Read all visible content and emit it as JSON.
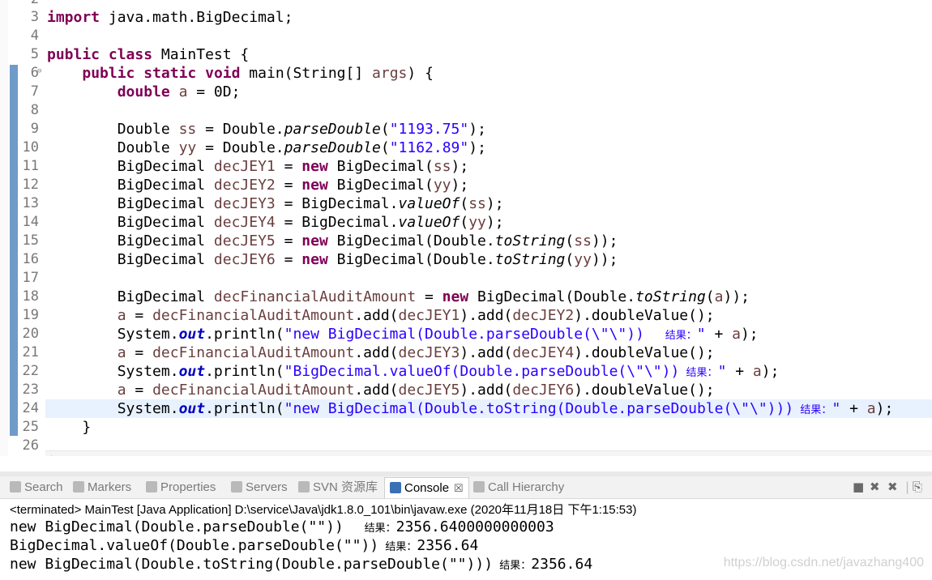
{
  "editor": {
    "first_line_partial": "2",
    "lines": [
      {
        "n": "3",
        "code": [
          {
            "t": "import",
            "c": "kw"
          },
          {
            "t": " java.math.BigDecimal;"
          }
        ]
      },
      {
        "n": "4",
        "code": []
      },
      {
        "n": "5",
        "code": [
          {
            "t": "public",
            "c": "kw"
          },
          {
            "t": " "
          },
          {
            "t": "class",
            "c": "kw"
          },
          {
            "t": " MainTest {"
          }
        ]
      },
      {
        "n": "6",
        "fold": "⊖",
        "code": [
          {
            "t": "    "
          },
          {
            "t": "public",
            "c": "kw"
          },
          {
            "t": " "
          },
          {
            "t": "static",
            "c": "kw"
          },
          {
            "t": " "
          },
          {
            "t": "void",
            "c": "kw"
          },
          {
            "t": " main(String[] "
          },
          {
            "t": "args",
            "c": "var"
          },
          {
            "t": ") {"
          }
        ]
      },
      {
        "n": "7",
        "code": [
          {
            "t": "        "
          },
          {
            "t": "double",
            "c": "kw"
          },
          {
            "t": " "
          },
          {
            "t": "a",
            "c": "var"
          },
          {
            "t": " = 0D;"
          }
        ]
      },
      {
        "n": "8",
        "code": []
      },
      {
        "n": "9",
        "code": [
          {
            "t": "        Double "
          },
          {
            "t": "ss",
            "c": "var"
          },
          {
            "t": " = Double."
          },
          {
            "t": "parseDouble",
            "c": "it"
          },
          {
            "t": "("
          },
          {
            "t": "\"1193.75\"",
            "c": "str"
          },
          {
            "t": ");"
          }
        ]
      },
      {
        "n": "10",
        "code": [
          {
            "t": "        Double "
          },
          {
            "t": "yy",
            "c": "var"
          },
          {
            "t": " = Double."
          },
          {
            "t": "parseDouble",
            "c": "it"
          },
          {
            "t": "("
          },
          {
            "t": "\"1162.89\"",
            "c": "str"
          },
          {
            "t": ");"
          }
        ]
      },
      {
        "n": "11",
        "code": [
          {
            "t": "        BigDecimal "
          },
          {
            "t": "decJEY1",
            "c": "var"
          },
          {
            "t": " = "
          },
          {
            "t": "new",
            "c": "kw"
          },
          {
            "t": " BigDecimal("
          },
          {
            "t": "ss",
            "c": "var"
          },
          {
            "t": ");"
          }
        ]
      },
      {
        "n": "12",
        "code": [
          {
            "t": "        BigDecimal "
          },
          {
            "t": "decJEY2",
            "c": "var"
          },
          {
            "t": " = "
          },
          {
            "t": "new",
            "c": "kw"
          },
          {
            "t": " BigDecimal("
          },
          {
            "t": "yy",
            "c": "var"
          },
          {
            "t": ");"
          }
        ]
      },
      {
        "n": "13",
        "code": [
          {
            "t": "        BigDecimal "
          },
          {
            "t": "decJEY3",
            "c": "var"
          },
          {
            "t": " = BigDecimal."
          },
          {
            "t": "valueOf",
            "c": "it"
          },
          {
            "t": "("
          },
          {
            "t": "ss",
            "c": "var"
          },
          {
            "t": ");"
          }
        ]
      },
      {
        "n": "14",
        "code": [
          {
            "t": "        BigDecimal "
          },
          {
            "t": "decJEY4",
            "c": "var"
          },
          {
            "t": " = BigDecimal."
          },
          {
            "t": "valueOf",
            "c": "it"
          },
          {
            "t": "("
          },
          {
            "t": "yy",
            "c": "var"
          },
          {
            "t": ");"
          }
        ]
      },
      {
        "n": "15",
        "code": [
          {
            "t": "        BigDecimal "
          },
          {
            "t": "decJEY5",
            "c": "var"
          },
          {
            "t": " = "
          },
          {
            "t": "new",
            "c": "kw"
          },
          {
            "t": " BigDecimal(Double."
          },
          {
            "t": "toString",
            "c": "it"
          },
          {
            "t": "("
          },
          {
            "t": "ss",
            "c": "var"
          },
          {
            "t": "));"
          }
        ]
      },
      {
        "n": "16",
        "code": [
          {
            "t": "        BigDecimal "
          },
          {
            "t": "decJEY6",
            "c": "var"
          },
          {
            "t": " = "
          },
          {
            "t": "new",
            "c": "kw"
          },
          {
            "t": " BigDecimal(Double."
          },
          {
            "t": "toString",
            "c": "it"
          },
          {
            "t": "("
          },
          {
            "t": "yy",
            "c": "var"
          },
          {
            "t": "));"
          }
        ]
      },
      {
        "n": "17",
        "code": []
      },
      {
        "n": "18",
        "code": [
          {
            "t": "        BigDecimal "
          },
          {
            "t": "decFinancialAuditAmount",
            "c": "var"
          },
          {
            "t": " = "
          },
          {
            "t": "new",
            "c": "kw"
          },
          {
            "t": " BigDecimal(Double."
          },
          {
            "t": "toString",
            "c": "it"
          },
          {
            "t": "("
          },
          {
            "t": "a",
            "c": "var"
          },
          {
            "t": "));"
          }
        ]
      },
      {
        "n": "19",
        "code": [
          {
            "t": "        "
          },
          {
            "t": "a",
            "c": "var"
          },
          {
            "t": " = "
          },
          {
            "t": "decFinancialAuditAmount",
            "c": "var"
          },
          {
            "t": ".add("
          },
          {
            "t": "decJEY1",
            "c": "var"
          },
          {
            "t": ").add("
          },
          {
            "t": "decJEY2",
            "c": "var"
          },
          {
            "t": ").doubleValue();"
          }
        ]
      },
      {
        "n": "20",
        "code": [
          {
            "t": "        System."
          },
          {
            "t": "out",
            "c": "fld"
          },
          {
            "t": ".println("
          },
          {
            "t": "\"new BigDecimal(Double.parseDouble(\\\"\\\"))  ",
            "c": "str"
          },
          {
            "t": " 结果：",
            "c": "str cn"
          },
          {
            "t": "\"",
            "c": "str"
          },
          {
            "t": " + "
          },
          {
            "t": "a",
            "c": "var"
          },
          {
            "t": ");"
          }
        ]
      },
      {
        "n": "21",
        "code": [
          {
            "t": "        "
          },
          {
            "t": "a",
            "c": "var"
          },
          {
            "t": " = "
          },
          {
            "t": "decFinancialAuditAmount",
            "c": "var"
          },
          {
            "t": ".add("
          },
          {
            "t": "decJEY3",
            "c": "var"
          },
          {
            "t": ").add("
          },
          {
            "t": "decJEY4",
            "c": "var"
          },
          {
            "t": ").doubleValue();"
          }
        ]
      },
      {
        "n": "22",
        "code": [
          {
            "t": "        System."
          },
          {
            "t": "out",
            "c": "fld"
          },
          {
            "t": ".println("
          },
          {
            "t": "\"BigDecimal.valueOf(Double.parseDouble(\\\"\\\"))",
            "c": "str"
          },
          {
            "t": "  结果：",
            "c": "str cn"
          },
          {
            "t": "\"",
            "c": "str"
          },
          {
            "t": " + "
          },
          {
            "t": "a",
            "c": "var"
          },
          {
            "t": ");"
          }
        ]
      },
      {
        "n": "23",
        "code": [
          {
            "t": "        "
          },
          {
            "t": "a",
            "c": "var"
          },
          {
            "t": " = "
          },
          {
            "t": "decFinancialAuditAmount",
            "c": "var"
          },
          {
            "t": ".add("
          },
          {
            "t": "decJEY5",
            "c": "var"
          },
          {
            "t": ").add("
          },
          {
            "t": "decJEY6",
            "c": "var"
          },
          {
            "t": ").doubleValue();"
          }
        ]
      },
      {
        "n": "24",
        "current": true,
        "code": [
          {
            "t": "        System."
          },
          {
            "t": "out",
            "c": "fld"
          },
          {
            "t": ".println("
          },
          {
            "t": "\"new BigDecimal(Double.toString(Double.parseDouble(\\\"\\\")))",
            "c": "str"
          },
          {
            "t": "  结果：",
            "c": "str cn"
          },
          {
            "t": "\"",
            "c": "str"
          },
          {
            "t": " + "
          },
          {
            "t": "a",
            "c": "var"
          },
          {
            "t": ");"
          }
        ]
      },
      {
        "n": "25",
        "code": [
          {
            "t": "    }"
          }
        ]
      },
      {
        "n": "26",
        "code": []
      }
    ]
  },
  "tabs": [
    {
      "label": "Search",
      "icon": "search-icon"
    },
    {
      "label": "Markers",
      "icon": "markers-icon"
    },
    {
      "label": "Properties",
      "icon": "properties-icon"
    },
    {
      "label": "Servers",
      "icon": "servers-icon"
    },
    {
      "label": "SVN 资源库",
      "icon": "svn-icon"
    },
    {
      "label": "Console",
      "icon": "console-icon",
      "active": true,
      "close": "☒"
    },
    {
      "label": "Call Hierarchy",
      "icon": "call-hierarchy-icon"
    }
  ],
  "console": {
    "status": "<terminated> MainTest [Java Application] D:\\service\\Java\\jdk1.8.0_101\\bin\\javaw.exe (2020年11月18日 下午1:15:53)",
    "output": [
      {
        "code": "new BigDecimal(Double.parseDouble(\"\"))  ",
        "label": " 结果：",
        "value": "2356.6400000000003"
      },
      {
        "code": "BigDecimal.valueOf(Double.parseDouble(\"\"))",
        "label": "  结果：",
        "value": "2356.64"
      },
      {
        "code": "new BigDecimal(Double.toString(Double.parseDouble(\"\")))",
        "label": "  结果：",
        "value": "2356.64"
      }
    ]
  },
  "watermark": "https://blog.csdn.net/javazhang400",
  "colors": {
    "keyword": "#7f0055",
    "string": "#2a00ff",
    "local_var": "#6a3e3e",
    "field": "#0000c0",
    "current_line": "#e8f2fe",
    "change_bar": "#6f9bc9"
  }
}
